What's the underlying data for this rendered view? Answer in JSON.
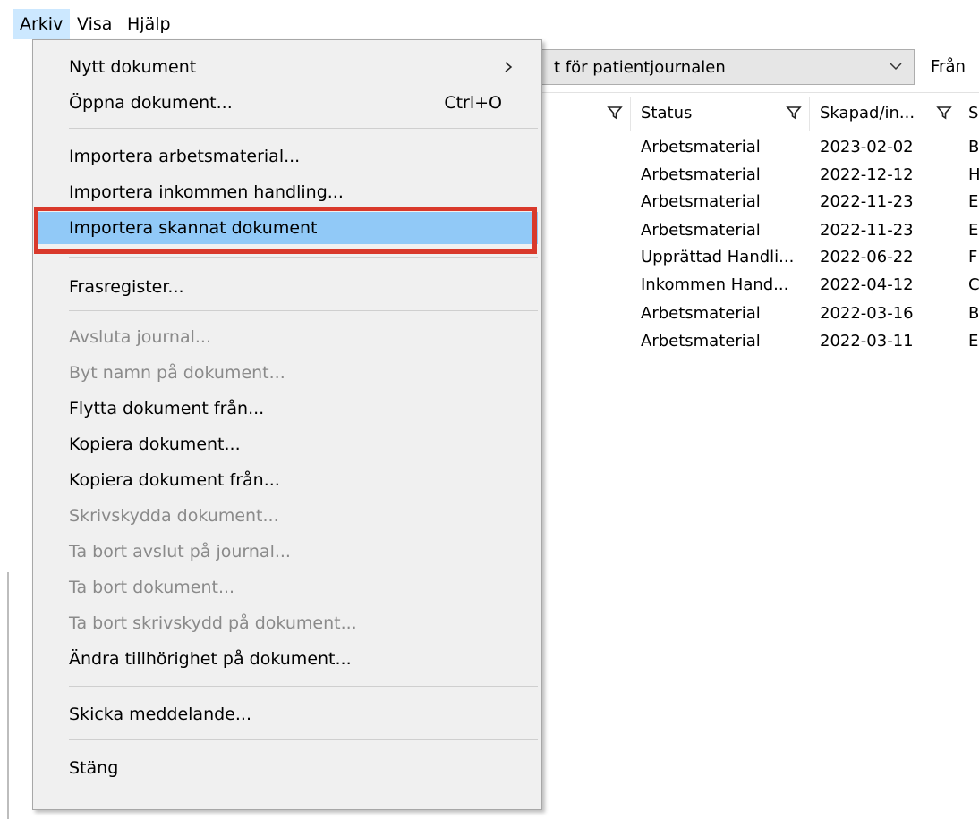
{
  "menubar": {
    "items": [
      {
        "label": "Arkiv"
      },
      {
        "label": "Visa"
      },
      {
        "label": "Hjälp"
      }
    ]
  },
  "toolbar": {
    "combo_text": "t för patientjournalen",
    "fran_label": "Från"
  },
  "table": {
    "headers": [
      "Status",
      "Skapad/in...",
      "S"
    ],
    "rows": [
      {
        "status": "Arbetsmaterial",
        "date": "2023-02-02",
        "extra": "B"
      },
      {
        "status": "Arbetsmaterial",
        "date": "2022-12-12",
        "extra": "H"
      },
      {
        "status": "Arbetsmaterial",
        "date": "2022-11-23",
        "extra": "E"
      },
      {
        "status": "Arbetsmaterial",
        "date": "2022-11-23",
        "extra": "E"
      },
      {
        "status": "Upprättad Handli...",
        "date": "2022-06-22",
        "extra": "F"
      },
      {
        "status": "Inkommen Hand...",
        "date": "2022-04-12",
        "extra": "C"
      },
      {
        "status": "Arbetsmaterial",
        "date": "2022-03-16",
        "extra": "B"
      },
      {
        "status": "Arbetsmaterial",
        "date": "2022-03-11",
        "extra": "E"
      }
    ]
  },
  "menu": {
    "items": [
      {
        "label": "Nytt dokument",
        "shortcut": "",
        "submenu": true,
        "disabled": false
      },
      {
        "label": "Öppna dokument...",
        "shortcut": "Ctrl+O",
        "submenu": false,
        "disabled": false
      },
      {
        "label": "Importera arbetsmaterial...",
        "shortcut": "",
        "submenu": false,
        "disabled": false
      },
      {
        "label": "Importera inkommen handling...",
        "shortcut": "",
        "submenu": false,
        "disabled": false
      },
      {
        "label": "Importera skannat dokument",
        "shortcut": "",
        "submenu": false,
        "disabled": false,
        "highlighted": true
      },
      {
        "label": "Frasregister...",
        "shortcut": "",
        "submenu": false,
        "disabled": false
      },
      {
        "label": "Avsluta journal...",
        "shortcut": "",
        "submenu": false,
        "disabled": true
      },
      {
        "label": "Byt namn på dokument...",
        "shortcut": "",
        "submenu": false,
        "disabled": true
      },
      {
        "label": "Flytta dokument från...",
        "shortcut": "",
        "submenu": false,
        "disabled": false
      },
      {
        "label": "Kopiera dokument...",
        "shortcut": "",
        "submenu": false,
        "disabled": false
      },
      {
        "label": "Kopiera dokument från...",
        "shortcut": "",
        "submenu": false,
        "disabled": false
      },
      {
        "label": "Skrivskydda dokument...",
        "shortcut": "",
        "submenu": false,
        "disabled": true
      },
      {
        "label": "Ta bort avslut på journal...",
        "shortcut": "",
        "submenu": false,
        "disabled": true
      },
      {
        "label": "Ta bort dokument...",
        "shortcut": "",
        "submenu": false,
        "disabled": true
      },
      {
        "label": "Ta bort skrivskydd på dokument...",
        "shortcut": "",
        "submenu": false,
        "disabled": true
      },
      {
        "label": "Ändra tillhörighet på dokument...",
        "shortcut": "",
        "submenu": false,
        "disabled": false
      },
      {
        "label": "Skicka meddelande...",
        "shortcut": "",
        "submenu": false,
        "disabled": false
      },
      {
        "label": "Stäng",
        "shortcut": "",
        "submenu": false,
        "disabled": false
      }
    ]
  },
  "colors": {
    "menu_highlight": "#91c9f7",
    "callout_border": "#d9392b",
    "menubar_active": "#cce8ff",
    "disabled_text": "#8a8a8a"
  }
}
